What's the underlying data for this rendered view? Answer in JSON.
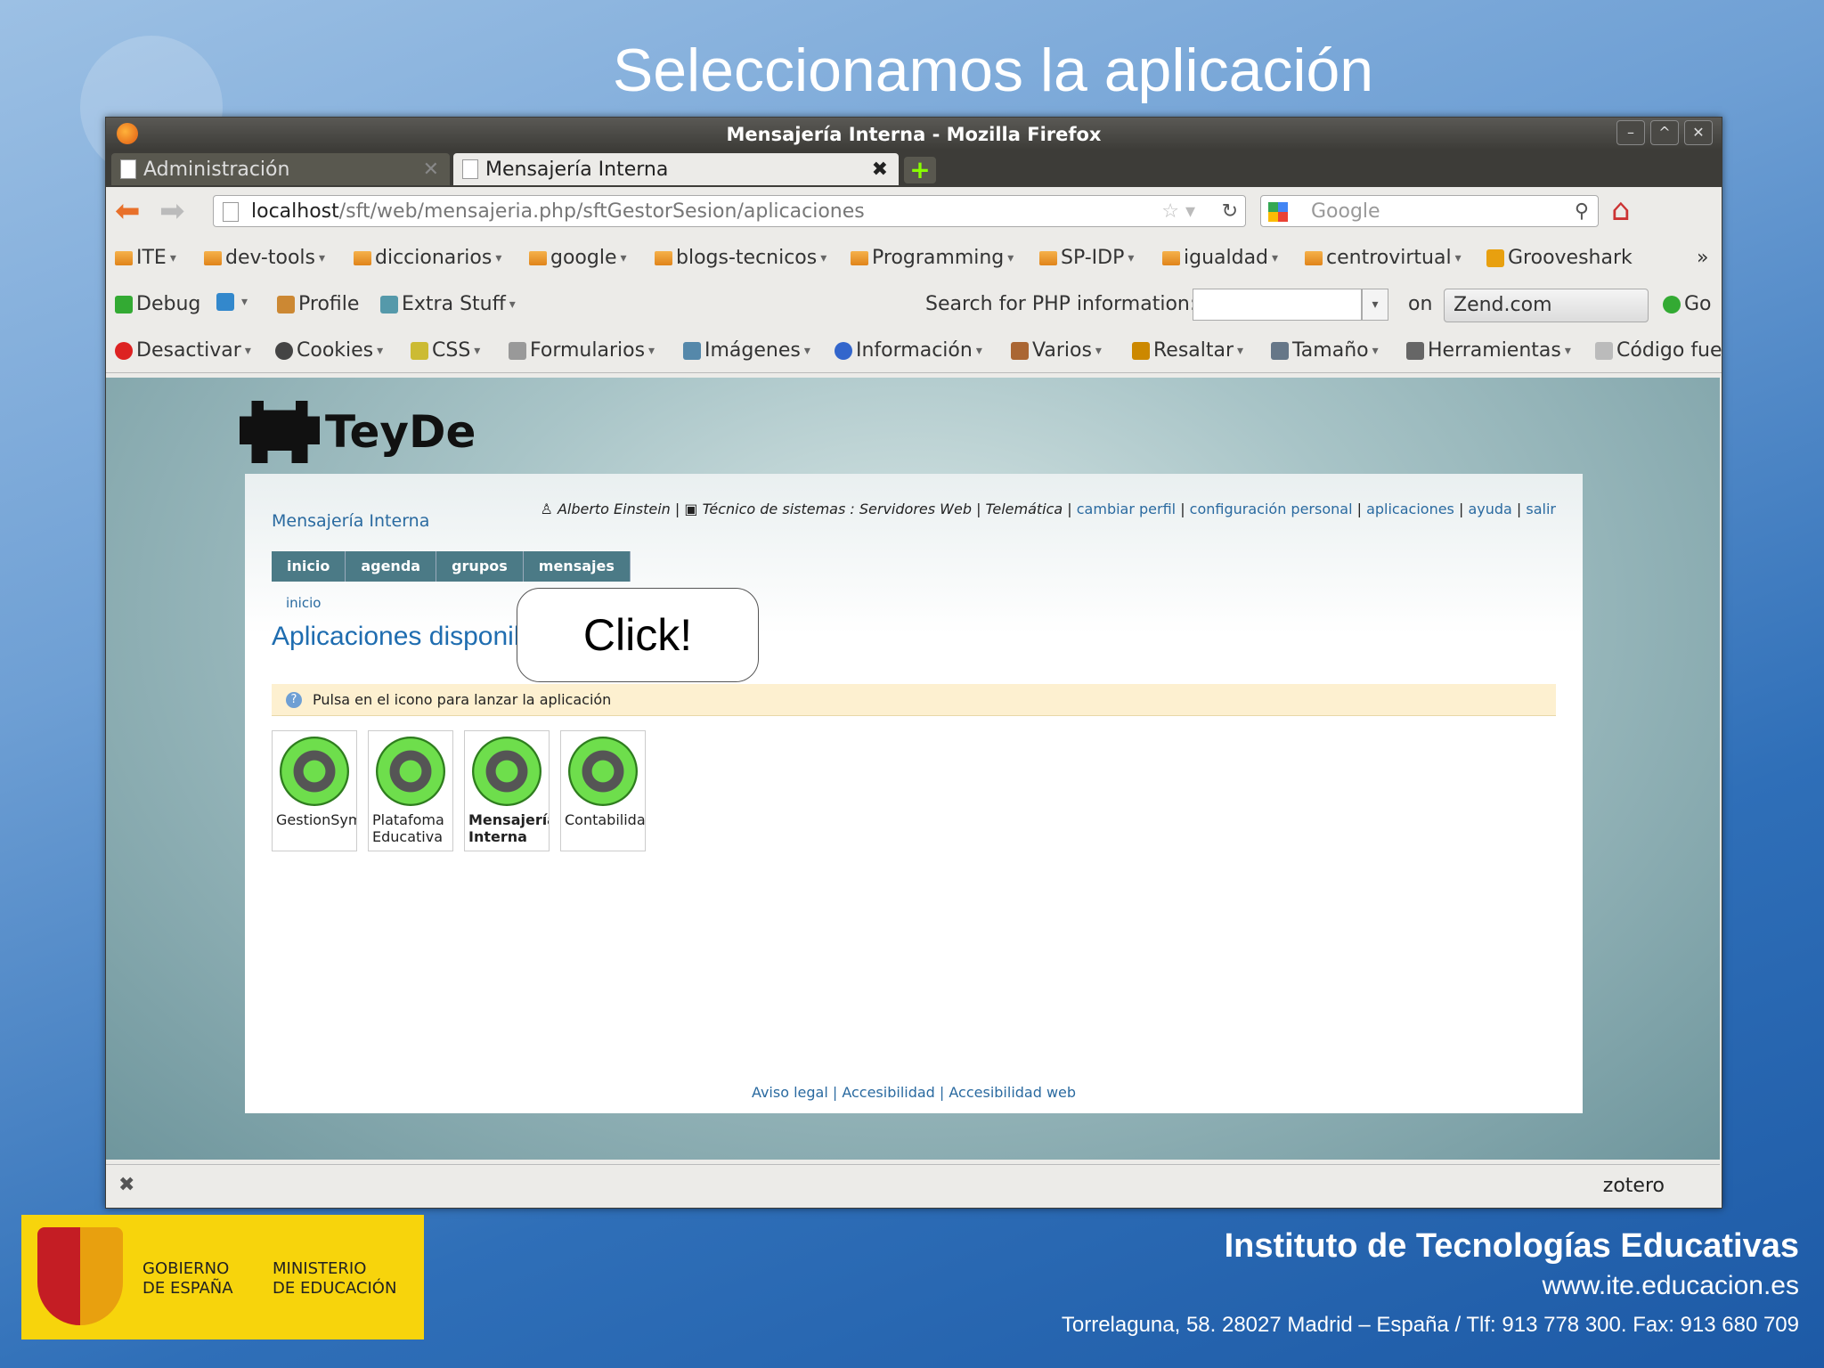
{
  "slide": {
    "title": "Seleccionamos la aplicación",
    "callout": "Click!",
    "institute": "Instituto de Tecnologías Educativas",
    "website": "www.ite.educacion.es",
    "address": "Torrelaguna, 58. 28027 Madrid – España / Tlf: 913 778 300. Fax: 913 680 709",
    "gov_line1": "GOBIERNO",
    "gov_line2": "DE ESPAÑA",
    "min_line1": "MINISTERIO",
    "min_line2": "DE EDUCACIÓN"
  },
  "window": {
    "title": "Mensajería Interna - Mozilla Firefox"
  },
  "tabs": [
    {
      "label": "Administración"
    },
    {
      "label": "Mensajería Interna"
    }
  ],
  "nav": {
    "url_host": "localhost",
    "url_path": "/sft/web/mensajeria.php/sftGestorSesion/aplicaciones",
    "search_placeholder": "Google"
  },
  "bookmarks": [
    "ITE",
    "dev-tools",
    "diccionarios",
    "google",
    "blogs-tecnicos",
    "Programming",
    "SP-IDP",
    "igualdad",
    "centrovirtual",
    "Grooveshark"
  ],
  "toolbar2": {
    "debug": "Debug",
    "profile": "Profile",
    "extra": "Extra Stuff",
    "php_label": "Search for PHP information:",
    "on": "on",
    "zend": "Zend.com",
    "go": "Go"
  },
  "webdev": [
    "Desactivar",
    "Cookies",
    "CSS",
    "Formularios",
    "Imágenes",
    "Información",
    "Varios",
    "Resaltar",
    "Tamaño",
    "Herramientas",
    "Código fue"
  ],
  "page": {
    "logo": "TeyDe",
    "app_title": "Mensajería Interna",
    "user": "Alberto Einstein",
    "role": "Técnico de sistemas : Servidores Web",
    "dept": "Telemática",
    "links": [
      "cambiar perfil",
      "configuración personal",
      "aplicaciones",
      "ayuda",
      "salir"
    ],
    "menu": [
      "inicio",
      "agenda",
      "grupos",
      "mensajes"
    ],
    "breadcrumb": "inicio",
    "heading": "Aplicaciones disponibles",
    "notice": "Pulsa en el icono para lanzar la aplicación",
    "apps": [
      {
        "label1": "GestionSymfony",
        "label2": ""
      },
      {
        "label1": "Platafoma",
        "label2": "Educativa"
      },
      {
        "label1": "Mensajería",
        "label2": "Interna"
      },
      {
        "label1": "Contabilidad",
        "label2": ""
      }
    ],
    "footer_links": [
      "Aviso legal",
      "Accesibilidad",
      "Accesibilidad web"
    ]
  },
  "statusbar": {
    "zotero": "zotero"
  },
  "colors": {
    "accent": "#1f6db0",
    "menu_bg": "#4b7a86",
    "notice_bg": "#fdf0d0",
    "gov_yellow": "#f7d40c"
  }
}
